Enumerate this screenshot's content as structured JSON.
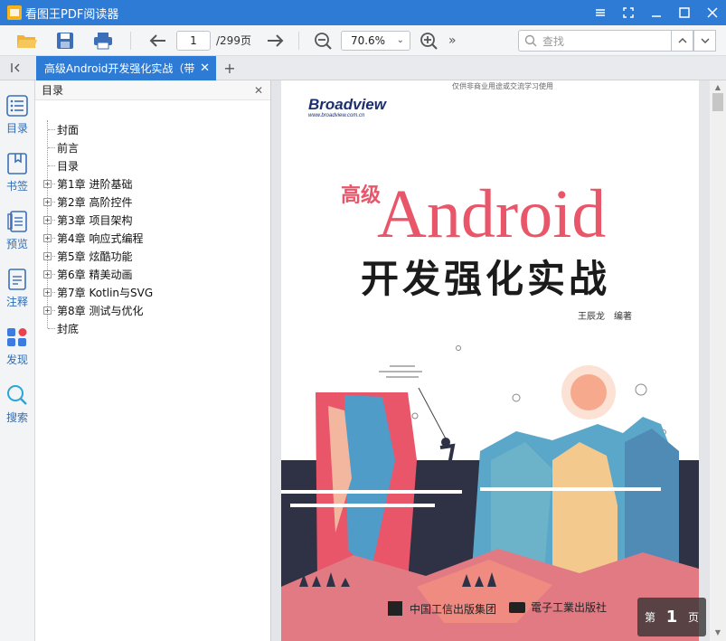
{
  "titlebar": {
    "title": "看图王PDF阅读器",
    "logo_text": "PDF"
  },
  "toolbar": {
    "current_page": "1",
    "total_pages": "/299页",
    "zoom": "70.6%",
    "more": "»",
    "search_placeholder": "查找"
  },
  "tabs": {
    "active_tab": "高级Android开发强化实战（带"
  },
  "rail": {
    "items": [
      {
        "label": "目录",
        "icon": "toc-icon"
      },
      {
        "label": "书签",
        "icon": "bookmark-icon"
      },
      {
        "label": "预览",
        "icon": "thumbnails-icon"
      },
      {
        "label": "注释",
        "icon": "annotation-icon"
      },
      {
        "label": "发现",
        "icon": "discover-icon"
      },
      {
        "label": "搜索",
        "icon": "search-icon"
      }
    ]
  },
  "toc": {
    "title": "目录",
    "items": [
      {
        "label": "封面",
        "expandable": false
      },
      {
        "label": "前言",
        "expandable": false
      },
      {
        "label": "目录",
        "expandable": false
      },
      {
        "label": "第1章 进阶基础",
        "expandable": true
      },
      {
        "label": "第2章 高阶控件",
        "expandable": true
      },
      {
        "label": "第3章 项目架构",
        "expandable": true
      },
      {
        "label": "第4章 响应式编程",
        "expandable": true
      },
      {
        "label": "第5章 炫酷功能",
        "expandable": true
      },
      {
        "label": "第6章 精美动画",
        "expandable": true
      },
      {
        "label": "第7章 Kotlin与SVG",
        "expandable": true
      },
      {
        "label": "第8章 测试与优化",
        "expandable": true
      },
      {
        "label": "封底",
        "expandable": false
      }
    ]
  },
  "cover": {
    "top_note": "仅供非商业用途或交流学习使用",
    "publisher_brand": "Broadview",
    "publisher_url": "www.broadview.com.cn",
    "title_small": "高级",
    "title_big": "Android",
    "subtitle": "开发强化实战",
    "author": "王辰龙　编著",
    "footer_left": "中国工信出版集团",
    "footer_right": "電子工業出版社"
  },
  "page_indicator": {
    "prefix": "第",
    "number": "1",
    "suffix": "页"
  },
  "colors": {
    "accent": "#2e7bd5",
    "title_red": "#e9566a",
    "sun": "#f7a98e"
  }
}
